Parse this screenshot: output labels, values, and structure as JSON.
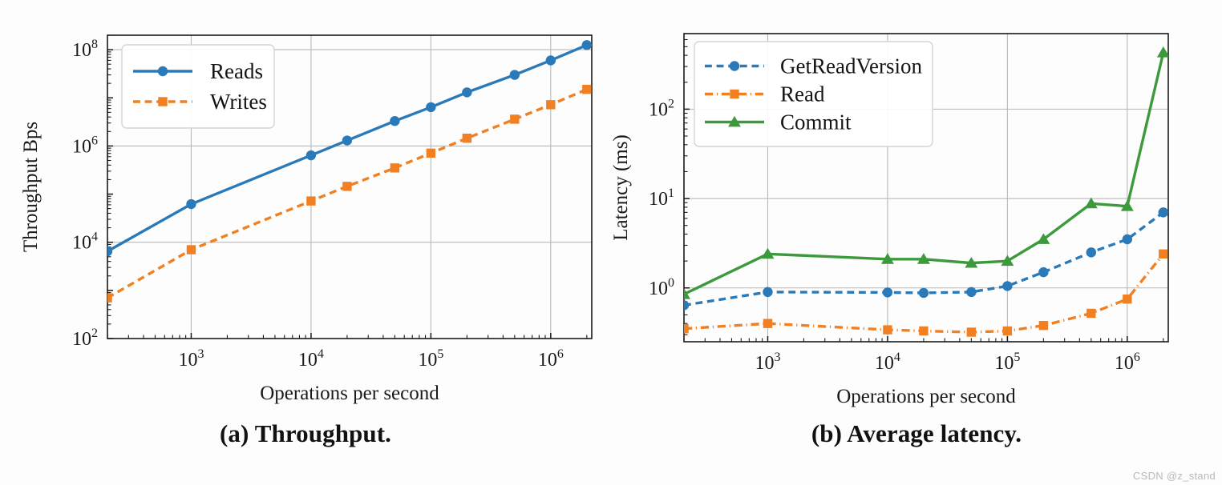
{
  "figure": {
    "background": "#fdfdfd",
    "watermark": "CSDN @z_stand"
  },
  "panels": [
    {
      "id": "a",
      "caption": "(a) Throughput.",
      "xlabel": "Operations per second",
      "ylabel": "Throughput Bps",
      "x_ticklabels": [
        "10^3",
        "10^4",
        "10^5",
        "10^6"
      ],
      "y_ticklabels": [
        "10^2",
        "10^4",
        "10^6",
        "10^8"
      ],
      "legend": [
        "Reads",
        "Writes"
      ]
    },
    {
      "id": "b",
      "caption": "(b) Average latency.",
      "xlabel": "Operations per second",
      "ylabel": "Latency (ms)",
      "x_ticklabels": [
        "10^3",
        "10^4",
        "10^5",
        "10^6"
      ],
      "y_ticklabels": [
        "10^0",
        "10^1",
        "10^2"
      ],
      "legend": [
        "GetReadVersion",
        "Read",
        "Commit"
      ]
    }
  ],
  "chart_data": [
    {
      "type": "line",
      "title": "(a) Throughput.",
      "xlabel": "Operations per second",
      "ylabel": "Throughput Bps",
      "xscale": "log",
      "yscale": "log",
      "xlim": [
        200,
        2200000
      ],
      "ylim": [
        100,
        200000000
      ],
      "xticks": [
        1000,
        10000,
        100000,
        1000000
      ],
      "xticklabels": [
        "10^3",
        "10^4",
        "10^5",
        "10^6"
      ],
      "yticks": [
        100,
        10000,
        1000000,
        100000000
      ],
      "yticklabels": [
        "10^2",
        "10^4",
        "10^6",
        "10^8"
      ],
      "grid": true,
      "legend_position": "upper left",
      "x": [
        200,
        1000,
        10000,
        20000,
        50000,
        100000,
        200000,
        500000,
        1000000,
        2000000
      ],
      "series": [
        {
          "name": "Reads",
          "color": "#2a7ab9",
          "marker": "circle",
          "linestyle": "solid",
          "values": [
            6500,
            62000,
            640000,
            1300000,
            3300000,
            6400000,
            13000000,
            30000000,
            60000000,
            125000000
          ]
        },
        {
          "name": "Writes",
          "color": "#f08022",
          "marker": "square",
          "linestyle": "dashed",
          "values": [
            700,
            7000,
            72000,
            145000,
            350000,
            710000,
            1450000,
            3600000,
            7200000,
            15000000
          ]
        }
      ]
    },
    {
      "type": "line",
      "title": "(b) Average latency.",
      "xlabel": "Operations per second",
      "ylabel": "Latency (ms)",
      "xscale": "log",
      "yscale": "log",
      "xlim": [
        200,
        2200000
      ],
      "ylim": [
        0.25,
        700
      ],
      "xticks": [
        1000,
        10000,
        100000,
        1000000
      ],
      "xticklabels": [
        "10^3",
        "10^4",
        "10^5",
        "10^6"
      ],
      "yticks": [
        1,
        10,
        100
      ],
      "yticklabels": [
        "10^0",
        "10^1",
        "10^2"
      ],
      "grid": true,
      "legend_position": "upper left",
      "x": [
        200,
        1000,
        10000,
        20000,
        50000,
        100000,
        200000,
        500000,
        1000000,
        2000000
      ],
      "series": [
        {
          "name": "GetReadVersion",
          "color": "#2a7ab9",
          "marker": "circle",
          "linestyle": "dashed",
          "values": [
            0.64,
            0.9,
            0.89,
            0.88,
            0.9,
            1.05,
            1.5,
            2.5,
            3.5,
            7.0
          ]
        },
        {
          "name": "Read",
          "color": "#f08022",
          "marker": "square",
          "linestyle": "dashdot",
          "values": [
            0.35,
            0.4,
            0.34,
            0.33,
            0.32,
            0.33,
            0.38,
            0.52,
            0.75,
            2.4
          ]
        },
        {
          "name": "Commit",
          "color": "#3c9a3c",
          "marker": "triangle",
          "linestyle": "solid",
          "values": [
            0.85,
            2.4,
            2.1,
            2.1,
            1.9,
            2.0,
            3.5,
            8.8,
            8.2,
            430
          ]
        }
      ]
    }
  ]
}
